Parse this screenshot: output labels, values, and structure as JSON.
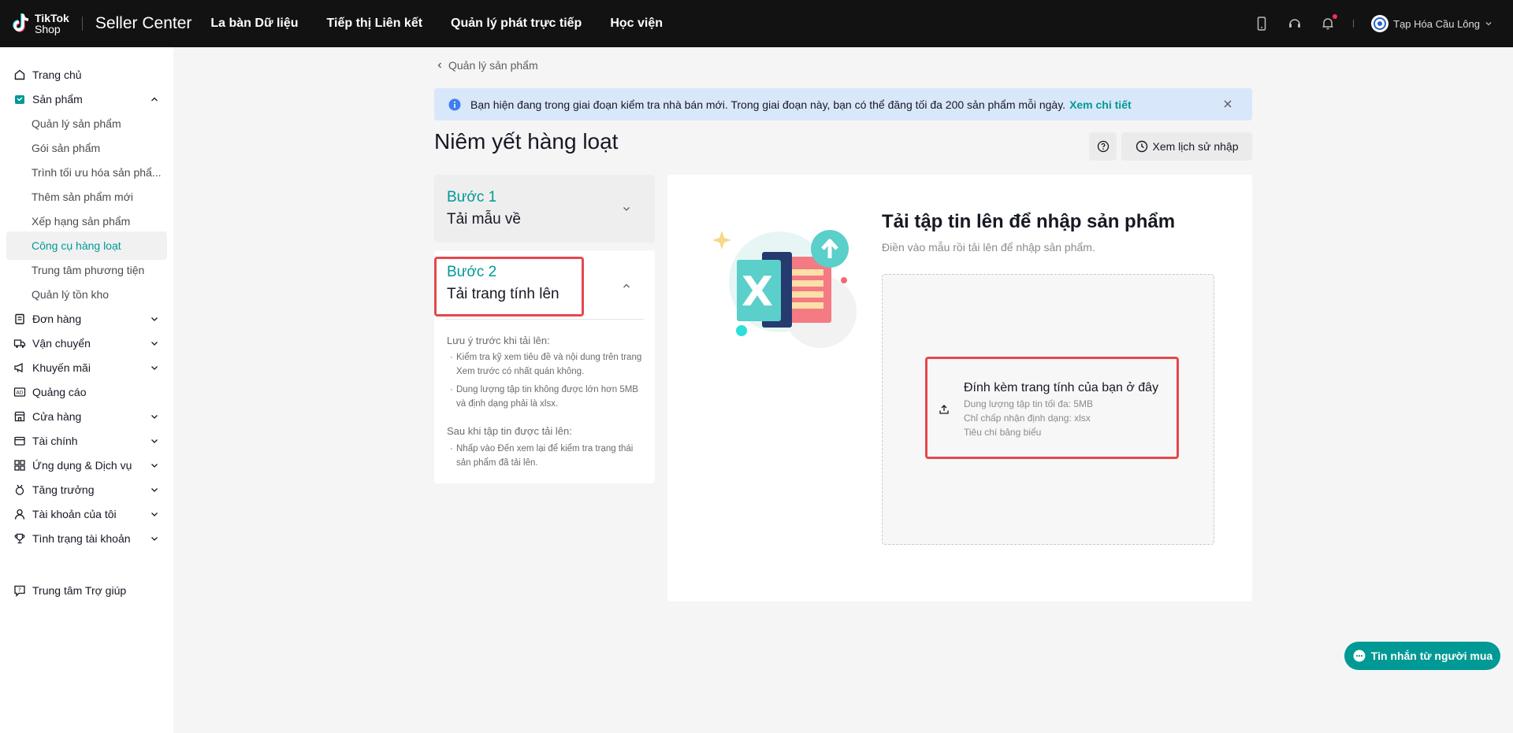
{
  "header": {
    "logo_line1": "TikTok",
    "logo_line2": "Shop",
    "product": "Seller Center",
    "nav": [
      "La bàn Dữ liệu",
      "Tiếp thị Liên kết",
      "Quản lý phát trực tiếp",
      "Học viện"
    ],
    "store_name": "Tạp Hóa Cầu Lông"
  },
  "sidebar": {
    "home": "Trang chủ",
    "products": "Sản phẩm",
    "product_sub": [
      "Quản lý sản phẩm",
      "Gói sản phẩm",
      "Trình tối ưu hóa sản phẩ...",
      "Thêm sản phẩm mới",
      "Xếp hạng sản phẩm",
      "Công cụ hàng loạt",
      "Trung tâm phương tiện",
      "Quản lý tồn kho"
    ],
    "sections": [
      "Đơn hàng",
      "Vận chuyển",
      "Khuyến mãi",
      "Quảng cáo",
      "Cửa hàng",
      "Tài chính",
      "Ứng dụng & Dịch vụ",
      "Tăng trưởng",
      "Tài khoản của tôi",
      "Tình trạng tài khoản"
    ],
    "help": "Trung tâm Trợ giúp"
  },
  "breadcrumb": "Quản lý sản phẩm",
  "banner": {
    "text": "Bạn hiện đang trong giai đoạn kiểm tra nhà bán mới. Trong giai đoạn này, bạn có thể đăng tối đa 200 sản phẩm mỗi ngày.",
    "link": "Xem chi tiết"
  },
  "page_title": "Niêm yết hàng loạt",
  "history_button": "Xem lịch sử nhập",
  "step1": {
    "num": "Bước 1",
    "name": "Tải mẫu về"
  },
  "step2": {
    "num": "Bước 2",
    "name": "Tải trang tính lên",
    "before_title": "Lưu ý trước khi tải lên:",
    "before_items": [
      "Kiểm tra kỹ xem tiêu đề và nội dung trên trang Xem trước có nhất quán không.",
      "Dung lượng tập tin không được lớn hơn 5MB và định dạng phải là xlsx."
    ],
    "after_title": "Sau khi tập tin được tải lên:",
    "after_items": [
      "Nhấp vào Đến xem lại để kiểm tra trạng thái sản phẩm đã tải lên."
    ]
  },
  "upload": {
    "title": "Tải tập tin lên để nhập sản phẩm",
    "subtitle": "Điền vào mẫu rồi tải lên để nhập sản phẩm.",
    "attach_title": "Đính kèm trang tính của bạn ở đây",
    "attach_lines": [
      "Dung lượng tập tin tối đa: 5MB",
      "Chỉ chấp nhận định dạng: xlsx",
      "Tiêu chí bảng biểu"
    ]
  },
  "chat_button": "Tin nhắn từ người mua",
  "colors": {
    "accent": "#009995",
    "highlight": "#e5484d",
    "topbar": "#121212",
    "banner": "#d9e7fb"
  }
}
